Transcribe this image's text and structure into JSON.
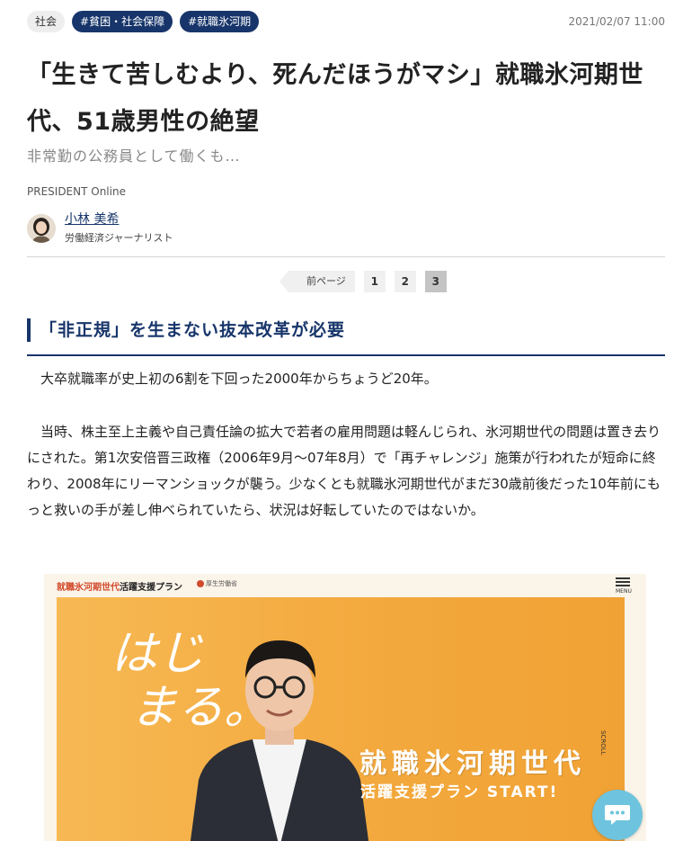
{
  "tags": [
    {
      "label": "社会",
      "style": "plain"
    },
    {
      "label": "#貧困・社会保障",
      "style": "hash"
    },
    {
      "label": "#就職氷河期",
      "style": "hash"
    }
  ],
  "date": "2021/02/07 11:00",
  "title": "「生きて苦しむより、死んだほうがマシ」就職氷河期世代、51歳男性の絶望",
  "subtitle": "非常勤の公務員として働くも…",
  "source": "PRESIDENT Online",
  "author": {
    "name": "小林 美希",
    "role": "労働経済ジャーナリスト"
  },
  "pager": {
    "prev_label": "前ページ",
    "pages": [
      "1",
      "2",
      "3"
    ],
    "current": "3"
  },
  "section_heading": "「非正規」を生まない抜本改革が必要",
  "paragraphs": [
    "大卒就職率が史上初の6割を下回った2000年からちょうど20年。",
    "当時、株主至上主義や自己責任論の拡大で若者の雇用問題は軽んじられ、氷河期世代の問題は置き去りにされた。第1次安倍晋三政権（2006年9月～07年8月）で「再チャレンジ」施策が行われたが短命に終わり、2008年にリーマンショックが襲う。少なくとも就職氷河期世代がまだ30歳前後だった10年前にもっと救いの手が差し伸べられていたら、状況は好転していたのではないか。"
  ],
  "image": {
    "brand_red": "就職氷河期世代",
    "brand_black": "活躍支援プラン",
    "ministry": "厚生労働省",
    "menu": "MENU",
    "hajime_line1": "はじ",
    "hajime_line2": "まる。",
    "headline1": "就職氷河期世代",
    "headline2": "活躍支援プラン START!",
    "scroll": "SCROLL"
  },
  "colors": {
    "navy": "#17356a",
    "orange": "#f3a93e",
    "chat": "#6ec4de"
  }
}
